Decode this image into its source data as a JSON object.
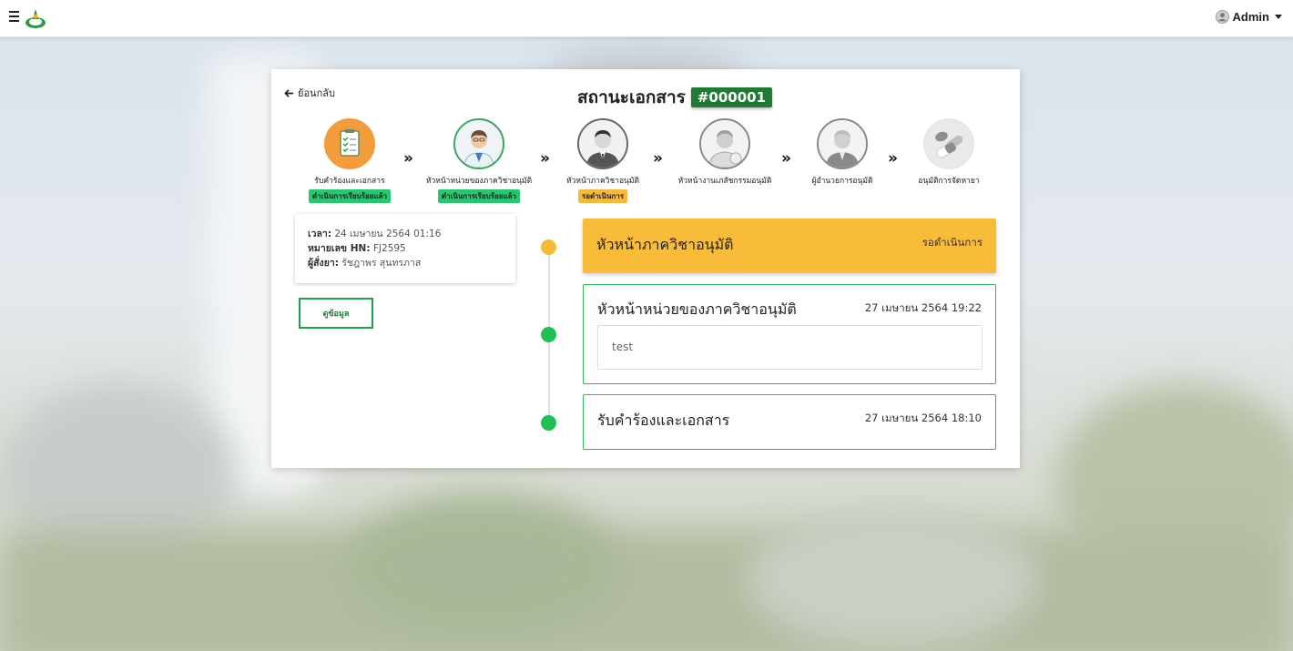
{
  "nav": {
    "user_name": "Admin"
  },
  "page": {
    "back_label": "ย้อนกลับ",
    "title": "สถานะเอกสาร",
    "doc_id": "#000001"
  },
  "steps": [
    {
      "label": "รับคำร้องและเอกสาร",
      "status": "ดำเนินการเรียบร้อยแล้ว",
      "state": "done",
      "icon": "clipboard-icon"
    },
    {
      "label": "หัวหน้าหน่วยของภาควิชาอนุมัติ",
      "status": "ดำเนินการเรียบร้อยแล้ว",
      "state": "done",
      "icon": "doctor-avatar-icon"
    },
    {
      "label": "หัวหน้าภาควิชาอนุมัติ",
      "status": "รอดำเนินการ",
      "state": "wait",
      "icon": "department-head-avatar-icon"
    },
    {
      "label": "หัวหน้างานเภสัชกรรมอนุมัติ",
      "status": "",
      "state": "inactive",
      "icon": "pharmacist-avatar-icon"
    },
    {
      "label": "ผู้อำนวยการอนุมัติ",
      "status": "",
      "state": "inactive",
      "icon": "director-avatar-icon"
    },
    {
      "label": "อนุมัติการจัดหายา",
      "status": "",
      "state": "inactive",
      "icon": "pills-icon"
    }
  ],
  "info": {
    "time_label": "เวลา:",
    "time_value": "24 เมษายน 2564 01:16",
    "hn_label": "หมายเลข HN:",
    "hn_value": "FJ2595",
    "orderer_label": "ผู้สั่งยา:",
    "orderer_value": "รัชฎาพร สุนทรภาส",
    "view_button": "ดูข้อมูล"
  },
  "timeline": [
    {
      "title": "หัวหน้าภาควิชาอนุมัติ",
      "meta": "รอดำเนินการ",
      "state": "pending"
    },
    {
      "title": "หัวหน้าหน่วยของภาควิชาอนุมัติ",
      "meta": "27 เมษายน 2564 19:22",
      "state": "done",
      "comment": "test"
    },
    {
      "title": "รับคำร้องและเอกสาร",
      "meta": "27 เมษายน 2564 18:10",
      "state": "done"
    }
  ],
  "colors": {
    "done": "#28c76f",
    "pending": "#f9bb3a",
    "doc_id_bg": "#1f7a34"
  }
}
